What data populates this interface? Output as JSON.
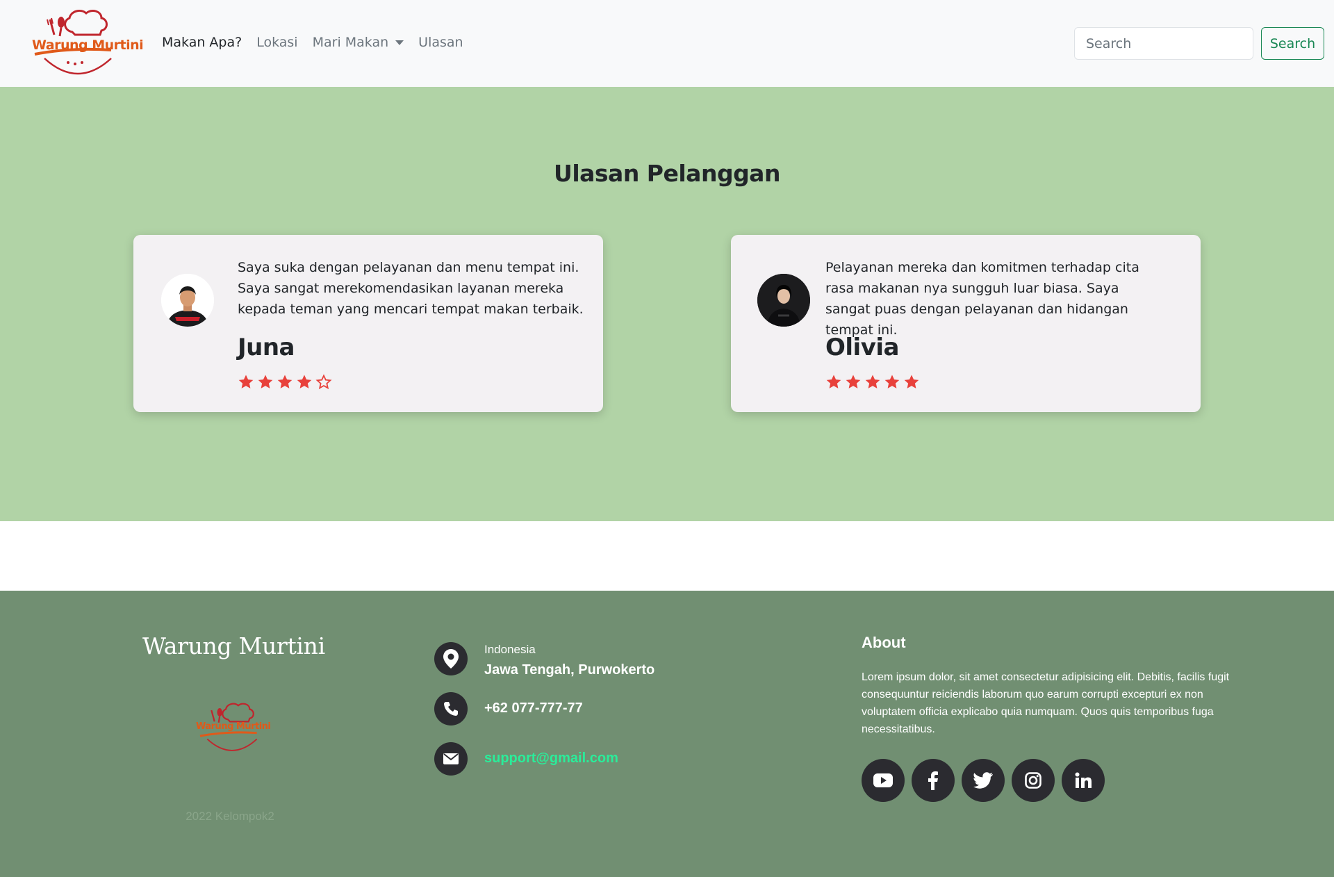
{
  "brand": {
    "logo_text": "Warung Murtini",
    "accent": "#e05a1a"
  },
  "nav": {
    "items": [
      {
        "label": "Makan Apa?"
      },
      {
        "label": "Lokasi"
      },
      {
        "label": "Mari Makan"
      },
      {
        "label": "Ulasan"
      }
    ],
    "active_color": "#212529",
    "link_color": "#6c757d"
  },
  "search": {
    "placeholder": "Search",
    "button_label": "Search",
    "accent": "#198754"
  },
  "reviews": {
    "title": "Ulasan Pelanggan",
    "background": "#b1d3a6",
    "items": [
      {
        "text": "Saya suka dengan pelayanan dan menu tempat ini. Saya sangat merekomendasikan layanan mereka kepada teman yang mencari tempat makan terbaik.",
        "name": "Juna",
        "rating": 4,
        "max_rating": 5
      },
      {
        "text": "Pelayanan mereka dan komitmen terhadap cita rasa makanan nya sungguh luar biasa. Saya sangat puas dengan pelayanan dan hidangan tempat ini.",
        "name": "Olivia",
        "rating": 5,
        "max_rating": 5
      }
    ],
    "star_color": "#e8413b"
  },
  "footer": {
    "brand_title": "Warung Murtini",
    "copyright": "2022 Kelompok2",
    "background": "#718f72",
    "contact": {
      "country": "Indonesia",
      "address": "Jawa Tengah, Purwokerto",
      "phone": "+62 077-777-77",
      "email": "support@gmail.com"
    },
    "about": {
      "title": "About",
      "text": "Lorem ipsum dolor, sit amet consectetur adipisicing elit. Debitis, facilis fugit consequuntur reiciendis laborum quo earum corrupti excepturi ex non voluptatem officia explicabo quia numquam. Quos quis temporibus fuga necessitatibus."
    },
    "socials": [
      "youtube-icon",
      "facebook-icon",
      "twitter-icon",
      "instagram-icon",
      "linkedin-icon"
    ]
  }
}
